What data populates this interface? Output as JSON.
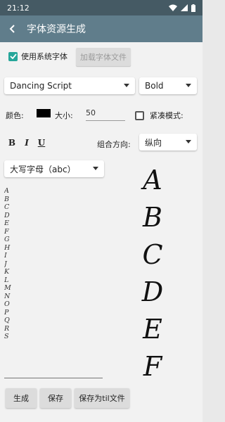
{
  "status_bar": {
    "time": "21:12"
  },
  "app_bar": {
    "title": "字体资源生成"
  },
  "options": {
    "use_system_font_label": "使用系统字体",
    "use_system_font_checked": true,
    "load_font_button": "加载字体文件",
    "font_family_value": "Dancing Script",
    "font_weight_value": "Bold",
    "color_label": "颜色:",
    "color_value": "#000000",
    "size_label": "大小:",
    "size_value": "50",
    "compact_label": "紧凑模式:",
    "compact_checked": false,
    "bold_button": "B",
    "italic_button": "I",
    "underline_button": "U",
    "direction_label": "组合方向:",
    "direction_value": "纵向",
    "charset_value": "大写字母（abc）"
  },
  "preview": {
    "letters": [
      "A",
      "B",
      "C",
      "D",
      "E",
      "F",
      "G",
      "H",
      "I",
      "J",
      "K",
      "L",
      "M",
      "N",
      "O",
      "P",
      "Q",
      "R",
      "S"
    ],
    "big_letters": [
      "A",
      "B",
      "C",
      "D",
      "E",
      "F"
    ]
  },
  "actions": {
    "generate": "生成",
    "save": "保存",
    "save_til": "保存为til文件"
  },
  "colors": {
    "status_bar": "#455a64",
    "app_bar": "#607d8b",
    "accent": "#26a69a"
  }
}
